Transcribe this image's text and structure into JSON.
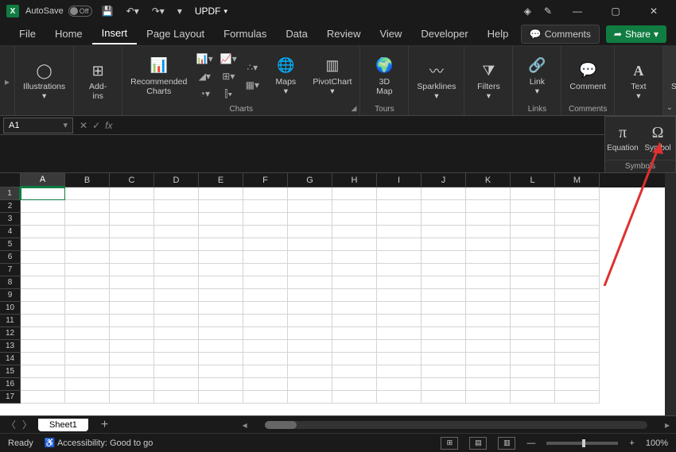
{
  "title_bar": {
    "autosave_label": "AutoSave",
    "autosave_state": "Off",
    "doc_name": "UPDF"
  },
  "tabs": [
    "File",
    "Home",
    "Insert",
    "Page Layout",
    "Formulas",
    "Data",
    "Review",
    "View",
    "Developer",
    "Help"
  ],
  "active_tab": "Insert",
  "header_buttons": {
    "comments": "Comments",
    "share": "Share"
  },
  "ribbon": {
    "illustrations": "Illustrations",
    "addins": "Add-\nins",
    "recommended": "Recommended\nCharts",
    "charts_group": "Charts",
    "maps": "Maps",
    "pivotchart": "PivotChart",
    "tours_group": "Tours",
    "map3d": "3D\nMap",
    "sparklines": "Sparklines",
    "filters": "Filters",
    "link": "Link",
    "links_group": "Links",
    "comment": "Comment",
    "comments_group": "Comments",
    "text": "Text",
    "symbols": "Symbols"
  },
  "symbols_dropdown": {
    "equation": "Equation",
    "symbol": "Symbol",
    "footer": "Symbols"
  },
  "name_box": "A1",
  "columns": [
    "A",
    "B",
    "C",
    "D",
    "E",
    "F",
    "G",
    "H",
    "I",
    "J",
    "K",
    "L",
    "M"
  ],
  "row_count": 17,
  "active_cell": {
    "row": 1,
    "col": "A"
  },
  "sheet": {
    "name": "Sheet1"
  },
  "status": {
    "ready": "Ready",
    "accessibility": "Accessibility: Good to go",
    "zoom": "100%"
  }
}
